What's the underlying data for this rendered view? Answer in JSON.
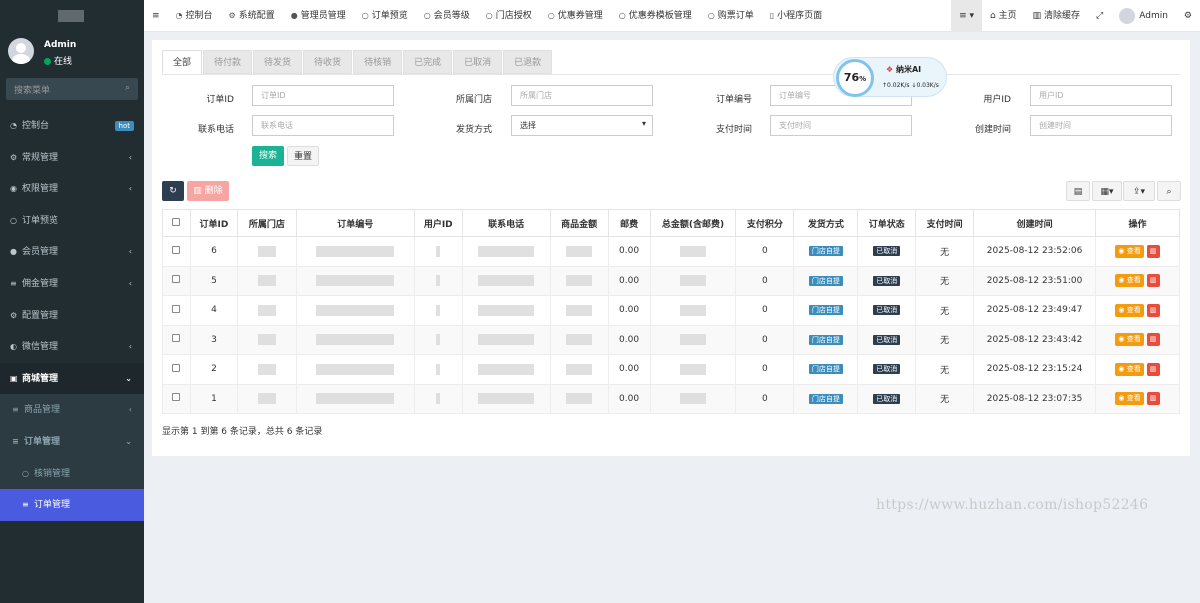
{
  "sidebar": {
    "user": {
      "name": "Admin",
      "status": "在线"
    },
    "search_placeholder": "搜索菜单",
    "items": [
      {
        "label": "控制台",
        "icon": "dashboard-icon",
        "badge": "hot"
      },
      {
        "label": "常规管理",
        "icon": "cogs-icon"
      },
      {
        "label": "权限管理",
        "icon": "group-icon"
      },
      {
        "label": "订单预览",
        "icon": "circle-icon"
      },
      {
        "label": "会员管理",
        "icon": "user-icon"
      },
      {
        "label": "佣金管理",
        "icon": "list-icon"
      },
      {
        "label": "配置管理",
        "icon": "cog-icon"
      },
      {
        "label": "微信管理",
        "icon": "wechat-icon"
      },
      {
        "label": "商城管理",
        "icon": "truck-icon"
      },
      {
        "label": "商品管理",
        "icon": "list-icon"
      },
      {
        "label": "订单管理",
        "icon": "list-icon"
      },
      {
        "label": "核销管理",
        "icon": "circle-icon"
      },
      {
        "label": "订单管理",
        "icon": "list-icon"
      }
    ]
  },
  "header": {
    "nav": [
      {
        "label": "控制台",
        "icon": "dashboard-icon"
      },
      {
        "label": "系统配置",
        "icon": "cog-icon"
      },
      {
        "label": "管理员管理",
        "icon": "user-icon"
      },
      {
        "label": "订单预览",
        "icon": "circle-icon"
      },
      {
        "label": "会员等级",
        "icon": "circle-icon"
      },
      {
        "label": "门店授权",
        "icon": "circle-icon"
      },
      {
        "label": "优惠券管理",
        "icon": "circle-icon"
      },
      {
        "label": "优惠券模板管理",
        "icon": "circle-icon"
      },
      {
        "label": "购票订单",
        "icon": "circle-icon"
      },
      {
        "label": "小程序页面",
        "icon": "bookmark-icon"
      }
    ],
    "right": {
      "home": "主页",
      "clear_cache": "清除缓存",
      "user": "Admin"
    }
  },
  "tabs": [
    "全部",
    "待付款",
    "待发货",
    "待收货",
    "待核销",
    "已完成",
    "已取消",
    "已退款"
  ],
  "filters": {
    "order_id": {
      "label": "订单ID",
      "placeholder": "订单ID"
    },
    "store": {
      "label": "所属门店",
      "placeholder": "所属门店"
    },
    "order_no": {
      "label": "订单编号",
      "placeholder": "订单编号"
    },
    "user_id": {
      "label": "用户ID",
      "placeholder": "用户ID"
    },
    "phone": {
      "label": "联系电话",
      "placeholder": "联系电话"
    },
    "ship": {
      "label": "发货方式",
      "value": "选择"
    },
    "pay_time": {
      "label": "支付时间",
      "placeholder": "支付时间"
    },
    "create_time": {
      "label": "创建时间",
      "placeholder": "创建时间"
    },
    "search_btn": "搜索",
    "reset_btn": "重置"
  },
  "toolbar": {
    "delete": "删除"
  },
  "ai_widget": {
    "percent": "76",
    "percent_unit": "%",
    "name": "纳米AI",
    "up": "0.02K/s",
    "down": "0.03K/s"
  },
  "table": {
    "headers": [
      "订单ID",
      "所属门店",
      "订单编号",
      "用户ID",
      "联系电话",
      "商品金额",
      "邮费",
      "总金额(含邮费)",
      "支付积分",
      "发货方式",
      "订单状态",
      "支付时间",
      "创建时间",
      "操作"
    ],
    "rows": [
      {
        "id": "6",
        "postage": "0.00",
        "points": "0",
        "ship": "门店自提",
        "status": "已取消",
        "pay_time": "无",
        "created": "2025-08-12 23:52:06"
      },
      {
        "id": "5",
        "postage": "0.00",
        "points": "0",
        "ship": "门店自提",
        "status": "已取消",
        "pay_time": "无",
        "created": "2025-08-12 23:51:00"
      },
      {
        "id": "4",
        "postage": "0.00",
        "points": "0",
        "ship": "门店自提",
        "status": "已取消",
        "pay_time": "无",
        "created": "2025-08-12 23:49:47"
      },
      {
        "id": "3",
        "postage": "0.00",
        "points": "0",
        "ship": "门店自提",
        "status": "已取消",
        "pay_time": "无",
        "created": "2025-08-12 23:43:42"
      },
      {
        "id": "2",
        "postage": "0.00",
        "points": "0",
        "ship": "门店自提",
        "status": "已取消",
        "pay_time": "无",
        "created": "2025-08-12 23:15:24"
      },
      {
        "id": "1",
        "postage": "0.00",
        "points": "0",
        "ship": "门店自提",
        "status": "已取消",
        "pay_time": "无",
        "created": "2025-08-12 23:07:35"
      }
    ],
    "view_label": "查看"
  },
  "pagination": "显示第 1 到第 6 条记录，总共 6 条记录",
  "watermark": "https://www.huzhan.com/ishop52246"
}
